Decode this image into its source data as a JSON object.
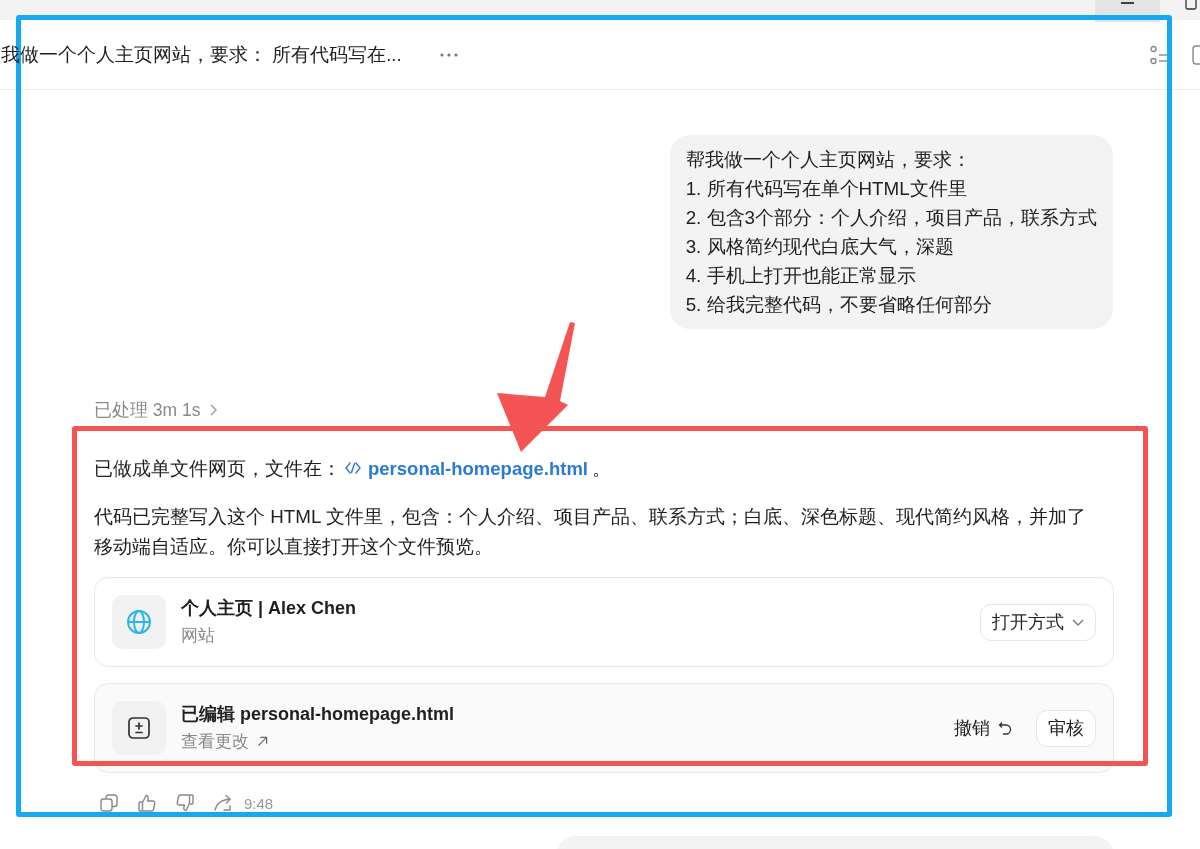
{
  "header": {
    "title": "我做一个个人主页网站，要求： 所有代码写在..."
  },
  "user_message": {
    "lines": [
      "帮我做一个个人主页网站，要求：",
      "1. 所有代码写在单个HTML文件里",
      "2. 包含3个部分：个人介绍，项目产品，联系方式",
      "3. 风格简约现代白底大气，深题",
      "4. 手机上打开也能正常显示",
      "5. 给我完整代码，不要省略任何部分"
    ]
  },
  "processing": {
    "label": "已处理 3m 1s"
  },
  "reply": {
    "paragraphs": [
      {
        "kind": "link",
        "before": "已做成单文件网页，文件在：",
        "link": "personal-homepage.html",
        "after": "。"
      },
      {
        "kind": "text",
        "text": "代码已完整写入这个 HTML 文件里，包含：个人介绍、项目产品、联系方式；白底、深色标题、现代简约风格，并加了移动端自适应。你可以直接打开这个文件预览。"
      }
    ]
  },
  "cards": [
    {
      "kind": "website",
      "title": "个人主页 | Alex Chen",
      "subtitle": {
        "kind": "text",
        "text": "网站"
      },
      "actions": [
        {
          "kind": "dropdown",
          "label": "打开方式"
        }
      ]
    },
    {
      "kind": "edit",
      "title": "已编辑 personal-homepage.html",
      "subtitle": {
        "kind": "link",
        "text": "查看更改"
      },
      "actions": [
        {
          "kind": "undo",
          "label": "撤销"
        },
        {
          "kind": "button",
          "label": "审核"
        }
      ]
    }
  ],
  "message_actions": {
    "time": "9:48"
  },
  "annotations": [
    {
      "kind": "outline",
      "color": "#17a9f0"
    },
    {
      "kind": "highlight",
      "color": "#f45454"
    },
    {
      "kind": "arrow",
      "color": "#f45454"
    }
  ]
}
